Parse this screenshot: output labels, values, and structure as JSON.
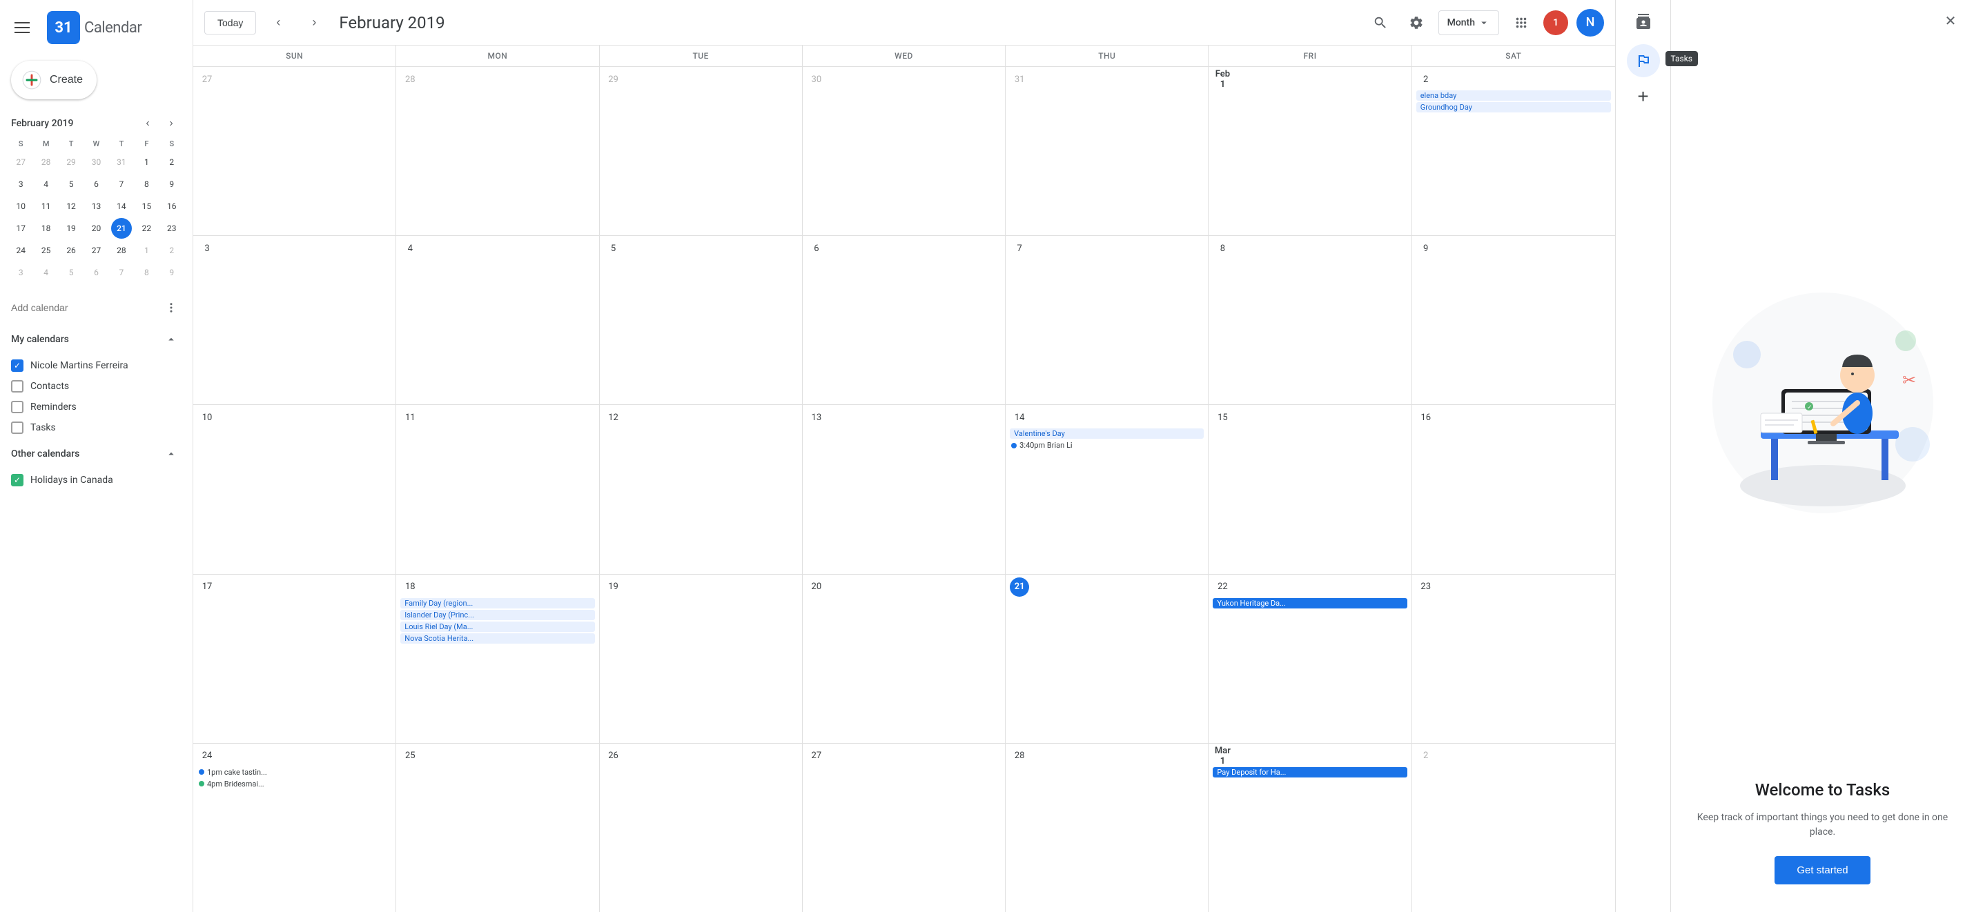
{
  "sidebar": {
    "logo_number": "31",
    "logo_text": "Calendar",
    "create_label": "Create",
    "mini_cal": {
      "title": "February 2019",
      "days_of_week": [
        "S",
        "M",
        "T",
        "W",
        "T",
        "F",
        "S"
      ],
      "weeks": [
        [
          {
            "num": "27",
            "other": true
          },
          {
            "num": "28",
            "other": true
          },
          {
            "num": "29",
            "other": true
          },
          {
            "num": "30",
            "other": true
          },
          {
            "num": "31",
            "other": true
          },
          {
            "num": "1"
          },
          {
            "num": "2"
          }
        ],
        [
          {
            "num": "3"
          },
          {
            "num": "4"
          },
          {
            "num": "5"
          },
          {
            "num": "6"
          },
          {
            "num": "7"
          },
          {
            "num": "8"
          },
          {
            "num": "9"
          }
        ],
        [
          {
            "num": "10"
          },
          {
            "num": "11"
          },
          {
            "num": "12"
          },
          {
            "num": "13"
          },
          {
            "num": "14"
          },
          {
            "num": "15"
          },
          {
            "num": "16"
          }
        ],
        [
          {
            "num": "17"
          },
          {
            "num": "18"
          },
          {
            "num": "19"
          },
          {
            "num": "20"
          },
          {
            "num": "21",
            "today": true
          },
          {
            "num": "22"
          },
          {
            "num": "23"
          }
        ],
        [
          {
            "num": "24"
          },
          {
            "num": "25"
          },
          {
            "num": "26"
          },
          {
            "num": "27"
          },
          {
            "num": "28"
          },
          {
            "num": "1",
            "other": true
          },
          {
            "num": "2",
            "other": true
          }
        ],
        [
          {
            "num": "3",
            "other": true
          },
          {
            "num": "4",
            "other": true
          },
          {
            "num": "5",
            "other": true
          },
          {
            "num": "6",
            "other": true
          },
          {
            "num": "7",
            "other": true
          },
          {
            "num": "8",
            "other": true
          },
          {
            "num": "9",
            "other": true
          }
        ]
      ]
    },
    "add_calendar_placeholder": "Add calendar",
    "my_calendars_title": "My calendars",
    "my_calendars": [
      {
        "label": "Nicole Martins Ferreira",
        "checked": true,
        "color": "blue"
      },
      {
        "label": "Contacts",
        "checked": false
      },
      {
        "label": "Reminders",
        "checked": false
      },
      {
        "label": "Tasks",
        "checked": false
      }
    ],
    "other_calendars_title": "Other calendars",
    "other_calendars": [
      {
        "label": "Holidays in Canada",
        "checked": true,
        "color": "green"
      }
    ]
  },
  "header": {
    "today_label": "Today",
    "month_title": "February 2019",
    "view_label": "Month",
    "notification_count": "1",
    "avatar_letter": "N"
  },
  "calendar": {
    "days_of_week": [
      "SUN",
      "MON",
      "TUE",
      "WED",
      "THU",
      "FRI",
      "SAT"
    ],
    "weeks": [
      {
        "cells": [
          {
            "day": "27",
            "other": true,
            "events": []
          },
          {
            "day": "28",
            "other": true,
            "events": []
          },
          {
            "day": "29",
            "other": true,
            "events": []
          },
          {
            "day": "30",
            "other": true,
            "events": []
          },
          {
            "day": "31",
            "other": true,
            "events": []
          },
          {
            "day": "Feb 1",
            "bold": true,
            "events": []
          },
          {
            "day": "2",
            "events": [
              {
                "type": "blue-light",
                "text": "elena bday"
              },
              {
                "type": "blue-light",
                "text": "Groundhog Day"
              }
            ]
          }
        ]
      },
      {
        "cells": [
          {
            "day": "3",
            "events": []
          },
          {
            "day": "4",
            "events": []
          },
          {
            "day": "5",
            "events": []
          },
          {
            "day": "6",
            "events": []
          },
          {
            "day": "7",
            "events": []
          },
          {
            "day": "8",
            "events": []
          },
          {
            "day": "9",
            "events": []
          }
        ]
      },
      {
        "cells": [
          {
            "day": "10",
            "events": []
          },
          {
            "day": "11",
            "events": []
          },
          {
            "day": "12",
            "events": []
          },
          {
            "day": "13",
            "events": []
          },
          {
            "day": "14",
            "events": [
              {
                "type": "blue-light",
                "text": "Valentine's Day"
              },
              {
                "type": "dot-event",
                "dot": "dot-blue",
                "text": "3:40pm Brian Li"
              }
            ]
          },
          {
            "day": "15",
            "events": []
          },
          {
            "day": "16",
            "events": []
          }
        ]
      },
      {
        "cells": [
          {
            "day": "17",
            "events": []
          },
          {
            "day": "18",
            "events": [
              {
                "type": "blue-light",
                "text": "Family Day (region..."
              },
              {
                "type": "blue-light",
                "text": "Islander Day (Princ..."
              },
              {
                "type": "blue-light",
                "text": "Louis Riel Day (Ma..."
              },
              {
                "type": "blue-light",
                "text": "Nova Scotia Herita..."
              }
            ]
          },
          {
            "day": "19",
            "events": []
          },
          {
            "day": "20",
            "events": []
          },
          {
            "day": "21",
            "today": true,
            "events": []
          },
          {
            "day": "22",
            "events": [
              {
                "type": "blue-solid",
                "text": "Yukon Heritage Da..."
              }
            ]
          },
          {
            "day": "23",
            "events": []
          }
        ]
      },
      {
        "cells": [
          {
            "day": "24",
            "events": [
              {
                "type": "dot-event",
                "dot": "dot-blue",
                "text": "1pm cake tastin..."
              },
              {
                "type": "dot-event",
                "dot": "dot-green",
                "text": "4pm Bridesmai..."
              }
            ]
          },
          {
            "day": "25",
            "events": []
          },
          {
            "day": "26",
            "events": []
          },
          {
            "day": "27",
            "events": []
          },
          {
            "day": "28",
            "events": []
          },
          {
            "day": "Mar 1",
            "bold": true,
            "events": [
              {
                "type": "blue-solid",
                "text": "Pay Deposit for Ha..."
              }
            ]
          },
          {
            "day": "2",
            "other": true,
            "events": []
          }
        ]
      }
    ]
  },
  "right_panel": {
    "icons": [
      "contacts-icon",
      "tasks-icon"
    ],
    "tasks_tooltip": "Tasks",
    "add_task_label": "+"
  },
  "tasks_panel": {
    "welcome_title": "Welcome to Tasks",
    "welcome_desc": "Keep track of important things you need to get done in one place.",
    "get_started_label": "Get started"
  }
}
